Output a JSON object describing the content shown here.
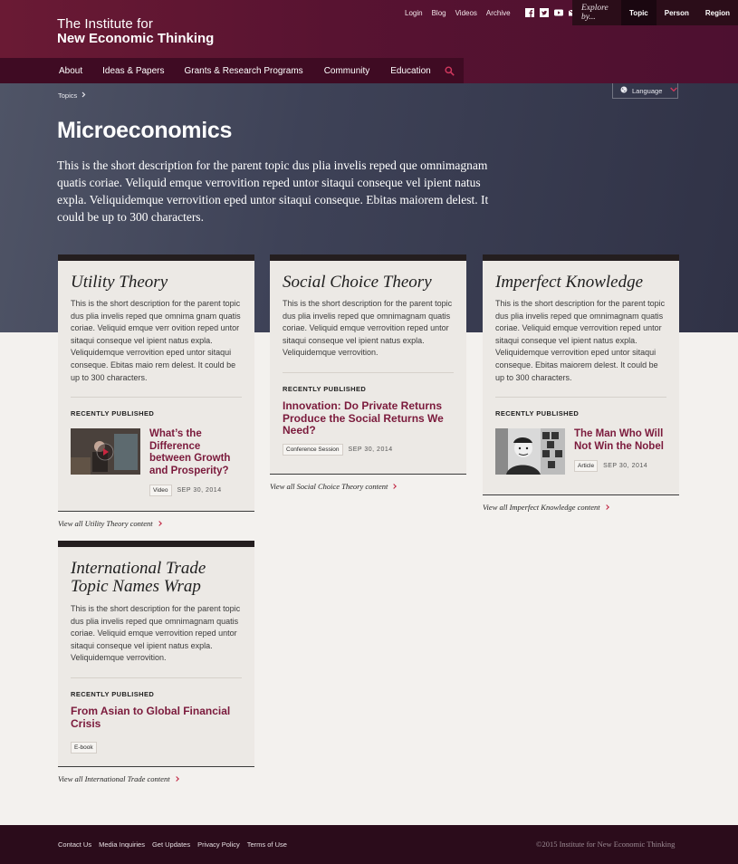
{
  "brand": {
    "line1": "The Institute for",
    "line2": "New Economic Thinking"
  },
  "utility_nav": {
    "login": "Login",
    "blog": "Blog",
    "videos": "Videos",
    "archive": "Archive"
  },
  "explore": {
    "label": "Explore by...",
    "options": [
      "Topic",
      "Person",
      "Region"
    ],
    "active": "Topic"
  },
  "main_nav": [
    "About",
    "Ideas & Papers",
    "Grants & Research Programs",
    "Community",
    "Education"
  ],
  "breadcrumb": {
    "label": "Topics"
  },
  "language": {
    "label": "Language"
  },
  "page": {
    "title": "Microeconomics",
    "description": "This is the short description for the parent topic dus plia invelis reped que omnimagnam quatis coriae. Veliquid emque verrovition reped untor sitaqui conseque vel ipient natus expla. Veliquidemque verrovition eped untor sitaqui conseque. Ebitas maiorem delest. It could be up to 300 characters."
  },
  "cards": [
    {
      "title": "Utility Theory",
      "description": "This is the short description for the parent topic dus plia invelis reped que omnima gnam quatis coriae. Veliquid emque verr ovition reped untor sitaqui conseque vel ipient natus expla. Veliquidemque verrovition eped untor sitaqui conseque. Ebitas maio rem  delest. It could be up to 300 characters.",
      "recent_label": "RECENTLY PUBLISHED",
      "item_title": "What’s the Difference between Growth and Prosperity?",
      "tag": "Video",
      "date": "SEP 30, 2014",
      "view_all": "View all Utility Theory content"
    },
    {
      "title": "Social Choice Theory",
      "description": "This is the short description for the parent topic dus plia invelis reped que omnimagnam quatis coriae. Veliquid emque verrovition reped untor sitaqui conseque vel ipient natus expla. Veliquidemque verrovition.",
      "recent_label": "RECENTLY PUBLISHED",
      "item_title": "Innovation: Do Private Returns Produce the Social Returns We Need?",
      "tag": "Conference Session",
      "date": "SEP 30, 2014",
      "view_all": "View all Social Choice Theory content"
    },
    {
      "title": "Imperfect Knowledge",
      "description": "This is the short description for the parent topic dus plia invelis reped que omnimagnam quatis coriae. Veliquid emque verrovition reped untor sitaqui conseque vel ipient natus expla. Veliquidemque verrovition eped untor sitaqui conseque. Ebitas maiorem delest. It could be up to 300 characters.",
      "recent_label": "RECENTLY PUBLISHED",
      "item_title": "The Man Who Will Not Win the Nobel",
      "tag": "Article",
      "date": "SEP 30, 2014",
      "view_all": "View all Imperfect Knowledge content"
    },
    {
      "title": "International Trade Topic Names Wrap",
      "description": "This is the short description for the parent topic dus plia invelis reped que omnimagnam quatis coriae. Veliquid emque verrovition reped untor sitaqui conseque vel ipient natus expla. Veliquidemque verrovition.",
      "recent_label": "RECENTLY PUBLISHED",
      "item_title": "From Asian to Global Financial Crisis",
      "tag": "E-book",
      "view_all": "View all International Trade content"
    }
  ],
  "footer": {
    "links": [
      "Contact Us",
      "Media Inquiries",
      "Get Updates",
      "Privacy Policy",
      "Terms of Use"
    ],
    "copyright": "©2015 Institute for New Economic Thinking"
  },
  "colors": {
    "brand": "#5a1430",
    "accent": "#7b1a3c",
    "hero": "#3e4257"
  }
}
